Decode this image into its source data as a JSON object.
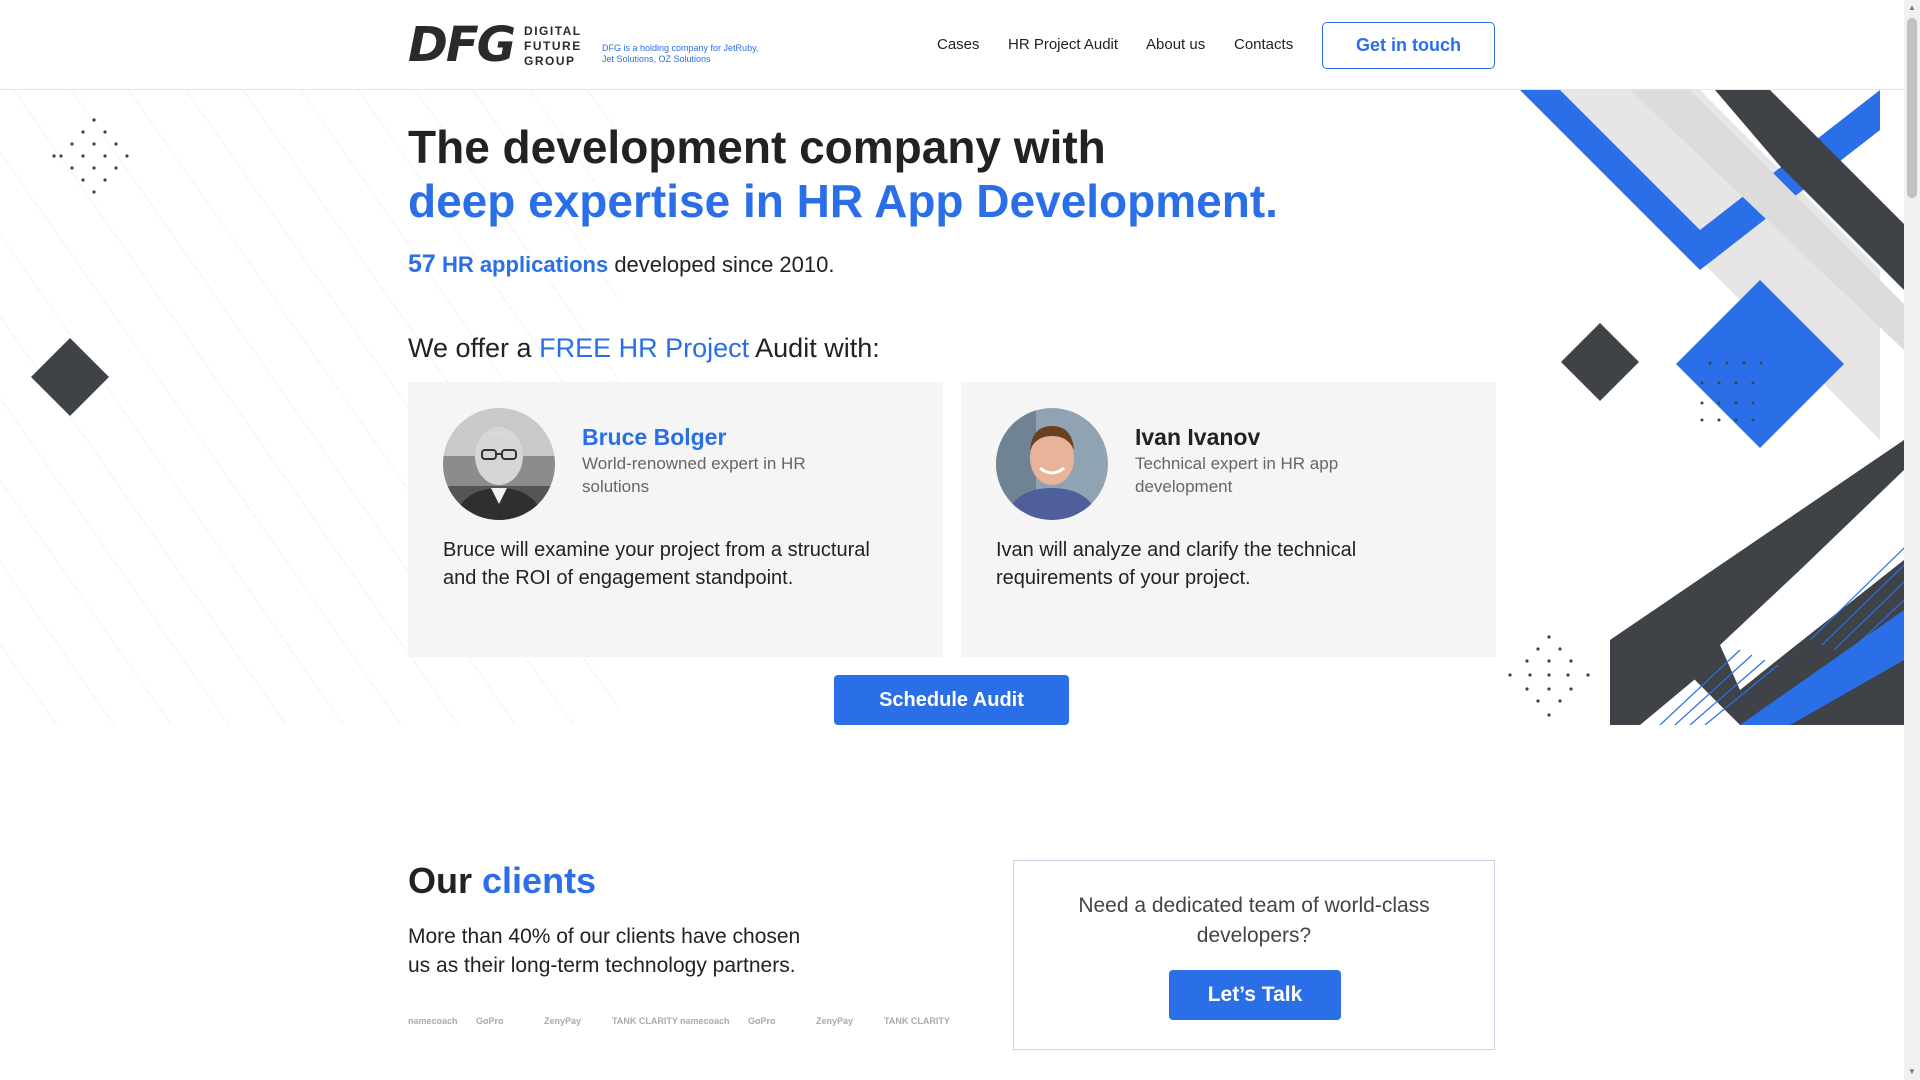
{
  "header": {
    "logo_mark": "DFG",
    "logo_words": [
      "DIGITAL",
      "FUTURE",
      "GROUP"
    ],
    "logo_tagline": "DFG is a holding company for JetRuby, Jet Solutions, OZ Solutions",
    "nav": [
      "Cases",
      "HR Project Audit",
      "About us",
      "Contacts"
    ],
    "cta": "Get in touch"
  },
  "hero": {
    "title_line1": "The development company with",
    "title_line2": "deep expertise in HR App Development.",
    "stat_number": "57",
    "stat_highlight": "HR applications",
    "stat_rest": "developed since 2010.",
    "offer_prefix": "We offer a",
    "offer_highlight": "FREE HR Project",
    "offer_suffix": "Audit with:"
  },
  "experts": [
    {
      "name": "Bruce Bolger",
      "role": "World-renowned expert in HR solutions",
      "description": "Bruce will examine your project from a structural and the ROI of engagement standpoint."
    },
    {
      "name": "Ivan Ivanov",
      "role": "Technical expert in HR app development",
      "description": "Ivan will analyze and clarify the technical requirements of your project."
    }
  ],
  "schedule_button": "Schedule Audit",
  "clients": {
    "title_prefix": "Our",
    "title_highlight": "clients",
    "text": "More than 40% of our clients have chosen us as their long-term technology partners.",
    "logos": [
      "namecoach",
      "GoPro",
      "ZenyPay",
      "TANK CLARITY",
      "namecoach",
      "GoPro",
      "ZenyPay",
      "TANK CLARITY"
    ]
  },
  "talk": {
    "question": "Need a dedicated team of world-class developers?",
    "button": "Let’s Talk"
  },
  "colors": {
    "accent": "#2a6fe8",
    "dark": "#3f4347",
    "card_bg": "#f5f5f5"
  }
}
